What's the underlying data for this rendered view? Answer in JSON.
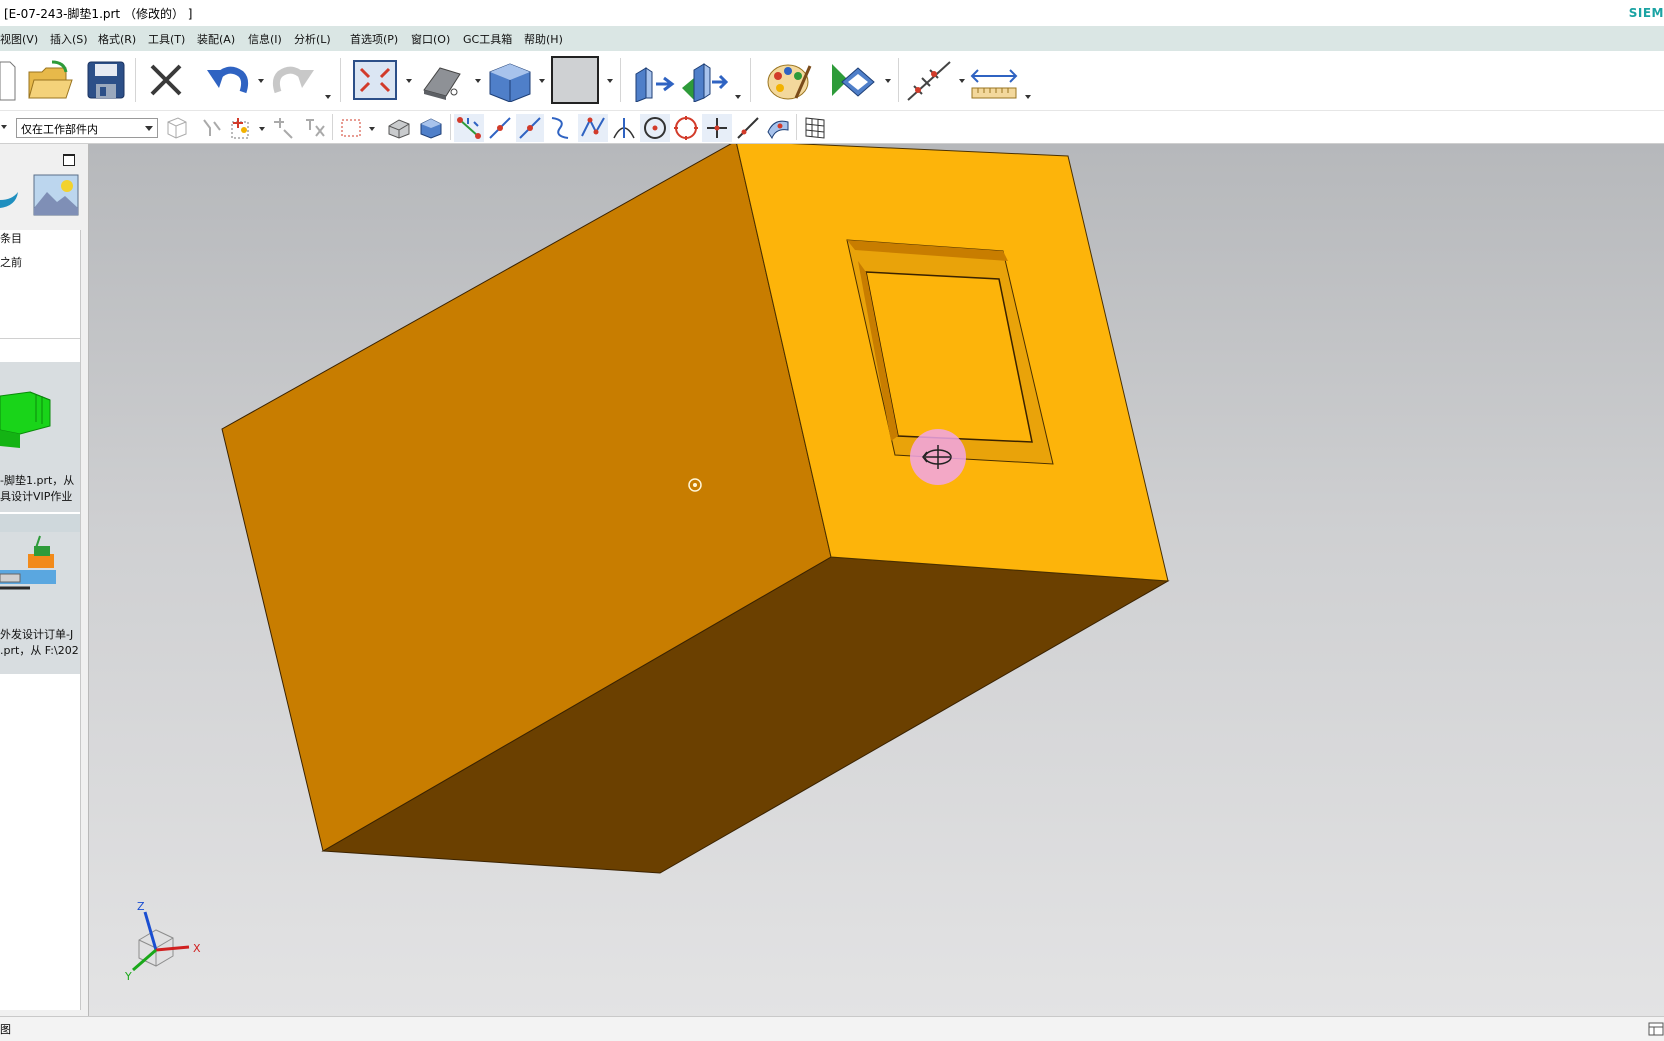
{
  "window": {
    "title": "[E-07-243-脚垫1.prt （修改的） ]",
    "brand": "SIEM"
  },
  "menu": [
    "视图(V)",
    "插入(S)",
    "格式(R)",
    "工具(T)",
    "装配(A)",
    "信息(I)",
    "分析(L)",
    "首选项(P)",
    "窗口(O)",
    "GC工具箱",
    "帮助(H)"
  ],
  "toolbar_main": {
    "icons": [
      "new-icon",
      "open-icon",
      "save-icon",
      "delete-icon",
      "undo-icon",
      "redo-icon",
      "fit-view-icon",
      "render-style-icon",
      "orient-view-icon",
      "background-icon",
      "extrude-feature-icon",
      "revolve-feature-icon",
      "palette-icon",
      "play-animation-icon",
      "measure-points-icon",
      "measure-distance-icon"
    ]
  },
  "toolbar_select": {
    "scope_value": "仅在工作部件内",
    "icons": [
      "general-selection-icon",
      "filter-icon",
      "point-snap-icon",
      "snap-options-icon",
      "rectangle-select-icon",
      "solid-body-icon",
      "face-icon",
      "endpoint-icon",
      "midpoint-icon",
      "control-point-icon",
      "curve-point-icon",
      "intersection-icon",
      "tangent-icon",
      "arc-center-icon",
      "quadrant-icon",
      "existing-point-icon",
      "point-on-curve-icon",
      "surface-point-icon",
      "grid-icon"
    ]
  },
  "left_panel": {
    "items": [
      "条目",
      "之前"
    ],
    "recent": [
      {
        "line1": "-脚垫1.prt，从",
        "line2": "具设计VIP作业"
      },
      {
        "line1": "外发设计订单-J",
        "line2": ".prt，从 F:\\202"
      }
    ]
  },
  "viewport": {
    "model": {
      "face_left_color": "#c87d00",
      "face_right_color": "#fdb40a",
      "face_bottom_color": "#6b4000",
      "pocket_color": "#fdb40a"
    },
    "axes": {
      "x": "X",
      "y": "Y",
      "z": "Z"
    }
  },
  "status": {
    "text": "图"
  }
}
